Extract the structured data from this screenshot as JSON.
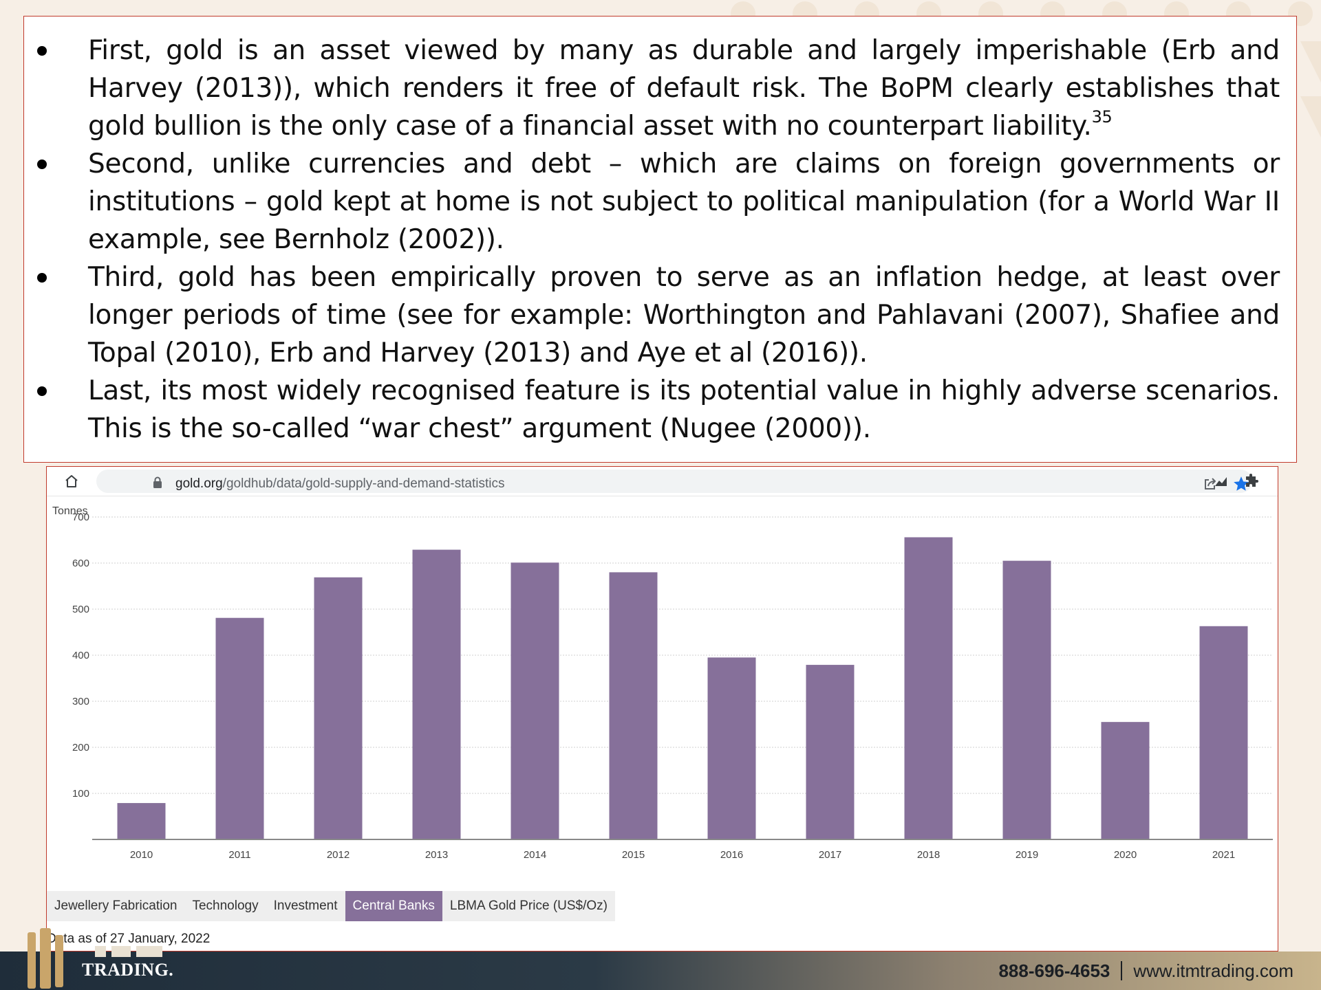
{
  "bullets": [
    {
      "text": "First, gold is an asset viewed by many as durable and largely imperishable (Erb and Harvey (2013)), which renders it free of default risk. The BoPM clearly establishes that gold bullion is the only case of a financial asset with no counterpart liability.",
      "footnote": "35"
    },
    {
      "text": "Second, unlike currencies and debt – which are claims on foreign governments or institutions – gold kept at home is not subject to political manipulation (for a World War II example, see Bernholz (2002))."
    },
    {
      "text": "Third, gold has been empirically proven to serve as an inflation hedge, at least over longer periods of time (see for example: Worthington and Pahlavani (2007), Shafiee and Topal (2010), Erb and Harvey (2013) and Aye et al (2016))."
    },
    {
      "text": "Last, its most widely recognised feature is its potential value in highly adverse scenarios. This is the so-called “war chest” argument (Nugee (2000))."
    }
  ],
  "browser": {
    "url_domain": "gold.org",
    "url_path": "/goldhub/data/gold-supply-and-demand-statistics"
  },
  "chart_data": {
    "type": "bar",
    "ylabel": "Tonnes",
    "categories": [
      "2010",
      "2011",
      "2012",
      "2013",
      "2014",
      "2015",
      "2016",
      "2017",
      "2018",
      "2019",
      "2020",
      "2021"
    ],
    "values": [
      79,
      481,
      569,
      629,
      601,
      580,
      395,
      379,
      656,
      605,
      255,
      463
    ],
    "ylim": [
      0,
      700
    ],
    "yticks": [
      100,
      200,
      300,
      400,
      500,
      600,
      700
    ],
    "grid": true,
    "bar_color": "#86709a"
  },
  "tabs": [
    {
      "label": "Jewellery Fabrication",
      "active": false
    },
    {
      "label": "Technology",
      "active": false
    },
    {
      "label": "Investment",
      "active": false
    },
    {
      "label": "Central Banks",
      "active": true
    },
    {
      "label": "LBMA Gold Price (US$/Oz)",
      "active": false
    }
  ],
  "data_note": "Data as of 27 January, 2022",
  "footer": {
    "logo_text": "TRADING.",
    "phone": "888-696-4653",
    "website": "www.itmtrading.com"
  }
}
